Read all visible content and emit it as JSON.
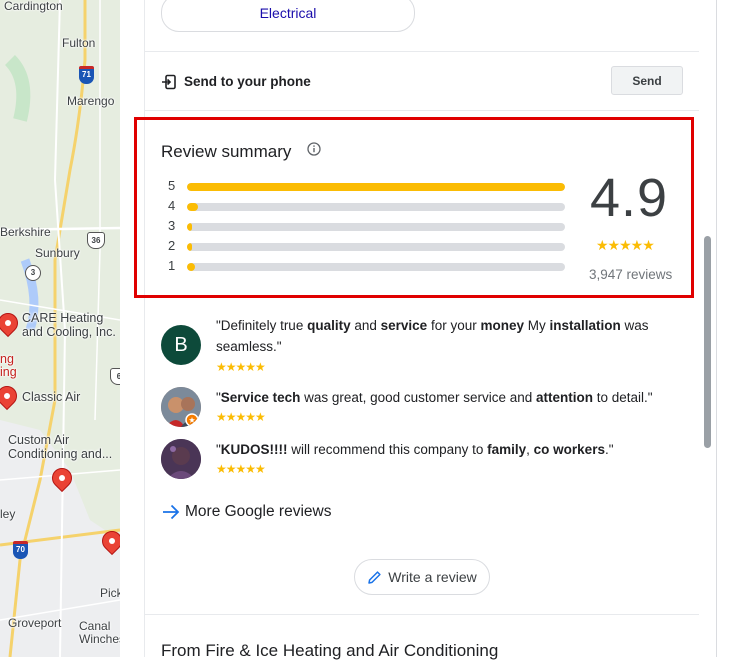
{
  "map": {
    "places": [
      "Cardington",
      "Fulton",
      "Marengo",
      "Berkshire",
      "Sunbury",
      "Groveport",
      "Canal Winchester",
      "Pick",
      "ley"
    ],
    "highway_shields": [
      "71",
      "36",
      "3",
      "70",
      "6"
    ],
    "businesses": [
      "CARE Heating and Cooling, Inc.",
      "Classic Air",
      "Custom Air Conditioning and...",
      "ng",
      "ing"
    ]
  },
  "chip": {
    "label": "Electrical"
  },
  "send": {
    "label": "Send to your phone",
    "button": "Send"
  },
  "summary": {
    "title": "Review summary",
    "rating": "4.9",
    "stars": "★★★★★",
    "review_count": "3,947 reviews",
    "distribution": [
      {
        "label": "5",
        "fraction": 1.0
      },
      {
        "label": "4",
        "fraction": 0.03
      },
      {
        "label": "3",
        "fraction": 0.005
      },
      {
        "label": "2",
        "fraction": 0.005
      },
      {
        "label": "1",
        "fraction": 0.02
      }
    ]
  },
  "reviews": [
    {
      "avatar_letter": "B",
      "avatar_color": "#0d4a3a",
      "parts": [
        {
          "text": "\"Definitely true ",
          "bold": false
        },
        {
          "text": "quality",
          "bold": true
        },
        {
          "text": " and ",
          "bold": false
        },
        {
          "text": "service",
          "bold": true
        },
        {
          "text": " for your ",
          "bold": false
        },
        {
          "text": "money",
          "bold": true
        },
        {
          "text": " My ",
          "bold": false
        },
        {
          "text": "installation",
          "bold": true
        },
        {
          "text": " was seamless.\"",
          "bold": false
        }
      ],
      "stars": "★★★★★"
    },
    {
      "avatar_letter": "",
      "avatar_color": "#8a6d5a",
      "parts": [
        {
          "text": "\"",
          "bold": false
        },
        {
          "text": "Service tech",
          "bold": true
        },
        {
          "text": " was great, good customer service and ",
          "bold": false
        },
        {
          "text": "attention",
          "bold": true
        },
        {
          "text": " to detail.\"",
          "bold": false
        }
      ],
      "stars": "★★★★★"
    },
    {
      "avatar_letter": "",
      "avatar_color": "#3b2a4a",
      "parts": [
        {
          "text": "\"",
          "bold": false
        },
        {
          "text": "KUDOS!!!!",
          "bold": true
        },
        {
          "text": " will recommend this company to ",
          "bold": false
        },
        {
          "text": "family",
          "bold": true
        },
        {
          "text": ", ",
          "bold": false
        },
        {
          "text": "co workers",
          "bold": true
        },
        {
          "text": ".\"",
          "bold": false
        }
      ],
      "stars": "★★★★★"
    }
  ],
  "more_reviews": {
    "label": "More Google reviews"
  },
  "write_review": {
    "label": "Write a review"
  },
  "from_section": {
    "title": "From Fire & Ice Heating and Air Conditioning"
  },
  "colors": {
    "star": "#fbbc04",
    "highlight_border": "#e00000",
    "link_blue": "#1a73e8"
  }
}
